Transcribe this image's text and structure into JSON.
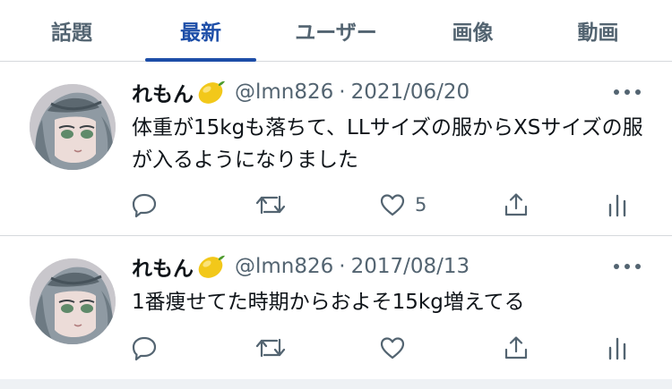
{
  "tabs": [
    {
      "label": "話題"
    },
    {
      "label": "最新"
    },
    {
      "label": "ユーザー"
    },
    {
      "label": "画像"
    },
    {
      "label": "動画"
    }
  ],
  "active_tab": "最新",
  "colors": {
    "accent": "#1d4ea8",
    "secondary_text": "#536471",
    "divider": "#d6d9dc"
  },
  "tweets": [
    {
      "name": "れもん",
      "name_emoji": "lemon",
      "handle": "@lmn826",
      "separator": "·",
      "date": "2021/06/20",
      "text": "体重が15kgも落ちて、LLサイズの服からXSサイズの服が入るようになりました",
      "like_count": "5"
    },
    {
      "name": "れもん",
      "name_emoji": "lemon",
      "handle": "@lmn826",
      "separator": "·",
      "date": "2017/08/13",
      "text": "1番痩せてた時期からおよそ15kg増えてる",
      "like_count": ""
    }
  ],
  "icons": [
    "reply-icon",
    "retweet-icon",
    "like-icon",
    "share-icon",
    "analytics-icon",
    "more-icon"
  ]
}
